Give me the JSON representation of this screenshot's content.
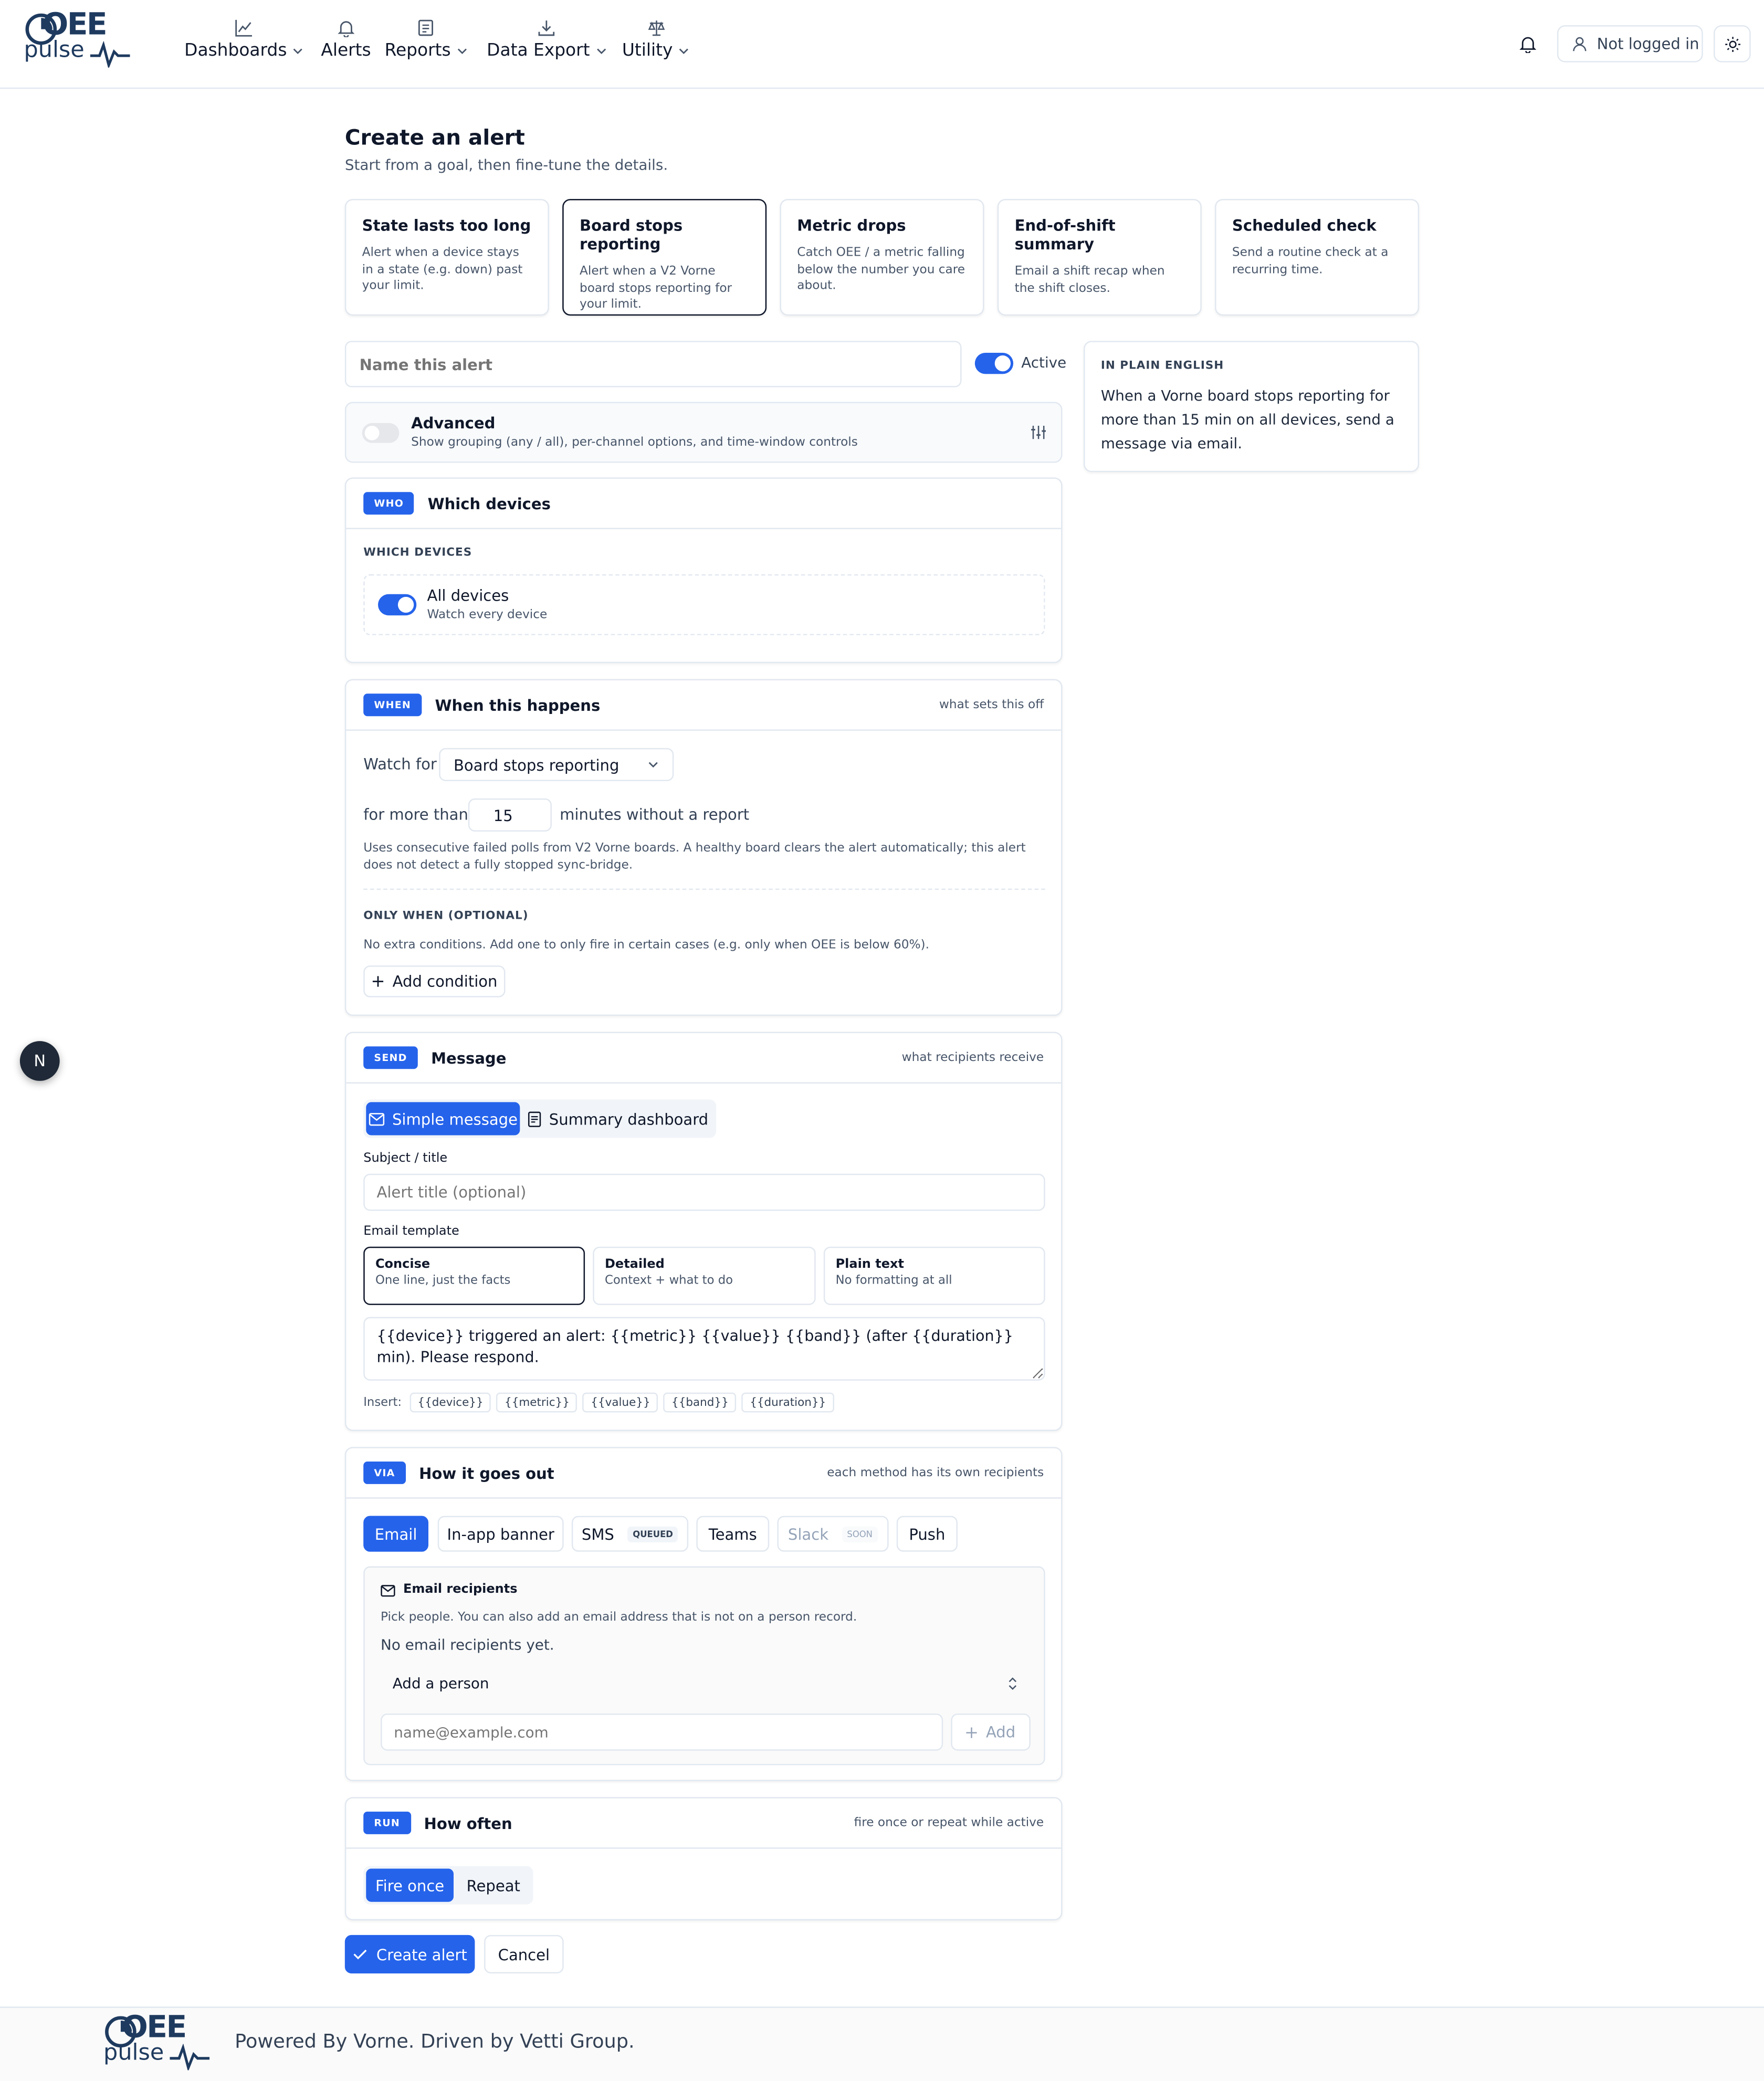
{
  "brand": {
    "logo_oee": "OEE",
    "logo_pulse": "pulse"
  },
  "nav": [
    {
      "label": "Dashboards",
      "icon": "chart-line-icon",
      "dropdown": true
    },
    {
      "label": "Alerts",
      "icon": "bell-icon",
      "dropdown": false
    },
    {
      "label": "Reports",
      "icon": "document-icon",
      "dropdown": true
    },
    {
      "label": "Data Export",
      "icon": "download-icon",
      "dropdown": true
    },
    {
      "label": "Utility",
      "icon": "scale-icon",
      "dropdown": true
    }
  ],
  "header": {
    "login_label": "Not logged in"
  },
  "page": {
    "title": "Create an alert",
    "subtitle": "Start from a goal, then fine-tune the details."
  },
  "templates": [
    {
      "title": "State lasts too long",
      "desc": "Alert when a device stays in a state (e.g. down) past your limit.",
      "selected": false
    },
    {
      "title": "Board stops reporting",
      "desc": "Alert when a V2 Vorne board stops reporting for your limit.",
      "selected": true
    },
    {
      "title": "Metric drops",
      "desc": "Catch OEE / a metric falling below the number you care about.",
      "selected": false
    },
    {
      "title": "End-of-shift summary",
      "desc": "Email a shift recap when the shift closes.",
      "selected": false
    },
    {
      "title": "Scheduled check",
      "desc": "Send a routine check at a recurring time.",
      "selected": false
    }
  ],
  "name_field": {
    "placeholder": "Name this alert",
    "value": ""
  },
  "active": {
    "label": "Active",
    "on": true
  },
  "advanced": {
    "title": "Advanced",
    "desc": "Show grouping (any / all), per-channel options, and time-window controls",
    "on": false
  },
  "plain_english": {
    "heading": "IN PLAIN ENGLISH",
    "text": "When a Vorne board stops reporting for more than 15 min on all devices, send a message via email."
  },
  "who": {
    "badge": "WHO",
    "title": "Which devices",
    "section_label": "WHICH DEVICES",
    "all_devices": {
      "label": "All devices",
      "desc": "Watch every device",
      "on": true
    }
  },
  "when": {
    "badge": "WHEN",
    "title": "When this happens",
    "hint": "what sets this off",
    "watch_label": "Watch for",
    "watch_value": "Board stops reporting",
    "for_label": "for more than",
    "minutes_value": "15",
    "minutes_suffix": "minutes without a report",
    "note": "Uses consecutive failed polls from V2 Vorne boards. A healthy board clears the alert automatically; this alert does not detect a fully stopped sync-bridge.",
    "only_when_label": "ONLY WHEN (OPTIONAL)",
    "only_when_desc": "No extra conditions. Add one to only fire in certain cases (e.g. only when OEE is below 60%).",
    "add_condition": "Add condition"
  },
  "send": {
    "badge": "SEND",
    "title": "Message",
    "hint": "what recipients receive",
    "tabs": [
      {
        "label": "Simple message",
        "active": true
      },
      {
        "label": "Summary dashboard",
        "active": false
      }
    ],
    "subject_label": "Subject / title",
    "subject_placeholder": "Alert title (optional)",
    "template_label": "Email template",
    "email_templates": [
      {
        "title": "Concise",
        "desc": "One line, just the facts",
        "selected": true
      },
      {
        "title": "Detailed",
        "desc": "Context + what to do",
        "selected": false
      },
      {
        "title": "Plain text",
        "desc": "No formatting at all",
        "selected": false
      }
    ],
    "body": "{{device}} triggered an alert: {{metric}} {{value}} {{band}} (after {{duration}} min). Please respond.",
    "insert_label": "Insert:",
    "inserts": [
      "{{device}}",
      "{{metric}}",
      "{{value}}",
      "{{band}}",
      "{{duration}}"
    ]
  },
  "via": {
    "badge": "VIA",
    "title": "How it goes out",
    "hint": "each method has its own recipients",
    "channels": [
      {
        "label": "Email",
        "tag": "",
        "active": true,
        "disabled": false
      },
      {
        "label": "In-app banner",
        "tag": "",
        "active": false,
        "disabled": false
      },
      {
        "label": "SMS",
        "tag": "QUEUED",
        "active": false,
        "disabled": false
      },
      {
        "label": "Teams",
        "tag": "",
        "active": false,
        "disabled": false
      },
      {
        "label": "Slack",
        "tag": "SOON",
        "active": false,
        "disabled": true
      },
      {
        "label": "Push",
        "tag": "",
        "active": false,
        "disabled": false
      }
    ],
    "recipients_title": "Email recipients",
    "recipients_desc": "Pick people. You can also add an email address that is not on a person record.",
    "empty": "No email recipients yet.",
    "add_person": "Add a person",
    "email_placeholder": "name@example.com",
    "add_button": "Add"
  },
  "run": {
    "badge": "RUN",
    "title": "How often",
    "hint": "fire once or repeat while active",
    "options": [
      {
        "label": "Fire once",
        "active": true
      },
      {
        "label": "Repeat",
        "active": false
      }
    ]
  },
  "actions": {
    "create": "Create alert",
    "cancel": "Cancel"
  },
  "footer": {
    "text": "Powered By Vorne. Driven by Vetti Group."
  },
  "floating": {
    "label": "N"
  },
  "colors": {
    "primary": "#2563eb",
    "brand": "#1e3a5f",
    "border": "#e2e8f0",
    "muted": "#475569"
  }
}
